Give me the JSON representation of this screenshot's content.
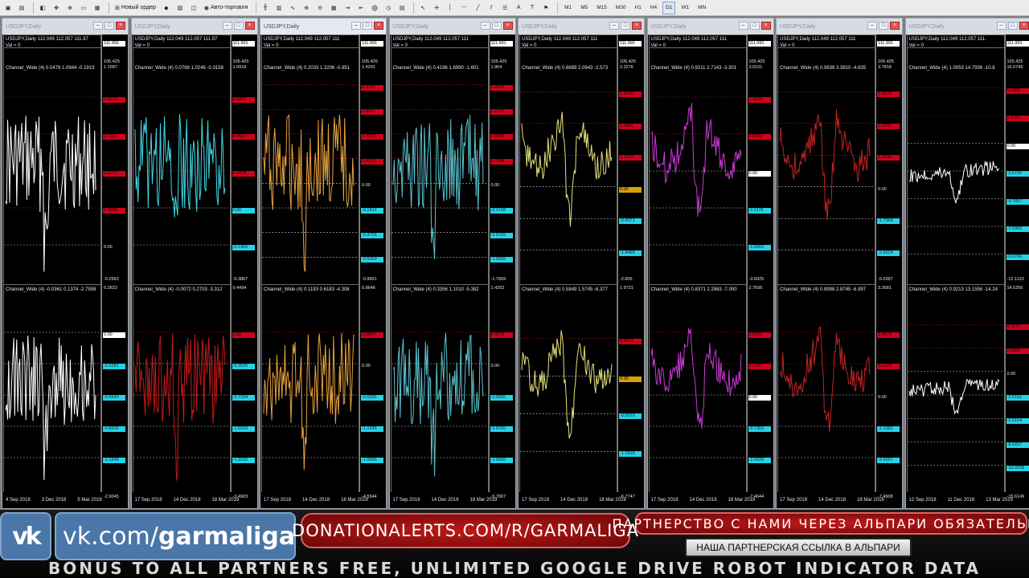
{
  "toolbar": {
    "new_order": "Новый ордер",
    "auto_trading": "Авто-торговля",
    "timeframes": [
      "M1",
      "M5",
      "M15",
      "M30",
      "H1",
      "H4",
      "D1",
      "W1",
      "MN"
    ],
    "active_timeframe": "D1",
    "draw_letters": [
      "A",
      "T"
    ]
  },
  "windows": [
    {
      "window_title": "USDJPY,Daily",
      "active": false,
      "symbol_label": "USDJPY,Daily  112.049 112.057 111.97",
      "val_label": "Val = 0",
      "ind1_label": "Channel_Wide (4) 0.0479 1.0944 -0.1919",
      "ind2_label": "Channel_Wide (4) -0.0361 0.1374 -2.7598",
      "price_top": "111.991",
      "price_low": "105.425",
      "ind1_top": "1.1587",
      "ind1_bottom": "-0.2563",
      "ind2_top": "0.2823",
      "ind2_bottom": "-2.9045",
      "ind1_levels": [
        {
          "text": "0.8679",
          "kind": "red"
        },
        {
          "text": "0.7112",
          "kind": "red"
        },
        {
          "text": "0.6077",
          "kind": "red"
        },
        {
          "text": "0.4646",
          "kind": "red"
        },
        {
          "text": "0.00",
          "kind": "black"
        }
      ],
      "ind2_levels": [
        {
          "text": "0.00",
          "kind": "white"
        },
        {
          "text": "-0.3281",
          "kind": "cyan"
        },
        {
          "text": "-0.6649",
          "kind": "cyan"
        },
        {
          "text": "-0.8626",
          "kind": "cyan"
        },
        {
          "text": "-1.1848",
          "kind": "cyan"
        }
      ],
      "dates": [
        "4 Sep 2018",
        "3 Dec 2018",
        "5 Mar 2019"
      ],
      "line_color": "#ffffff",
      "line_color2": "#ffffff"
    },
    {
      "window_title": "USDJPY,Daily",
      "active": false,
      "symbol_label": "USDJPY,Daily  112.049 112.057 111.97",
      "val_label": "Val = 0",
      "ind1_label": "Channel_Wide (4) 0.0768 1.0246 -0.3158",
      "ind2_label": "Channel_Wide (4) -0.0072 0.2703 -3.312",
      "price_top": "111.991",
      "price_low": "105.425",
      "ind1_top": "1.0918",
      "ind1_bottom": "-0.3867",
      "ind2_top": "0.4494",
      "ind2_bottom": "-3.4903",
      "ind1_levels": [
        {
          "text": "0.5862",
          "kind": "red"
        },
        {
          "text": "0.4612",
          "kind": "red"
        },
        {
          "text": "0.3479",
          "kind": "red"
        },
        {
          "text": "0.00",
          "kind": "cyan"
        },
        {
          "text": "-0.1460",
          "kind": "cyan"
        }
      ],
      "ind2_levels": [
        {
          "text": "0.00",
          "kind": "red"
        },
        {
          "text": "-0.3520",
          "kind": "cyan"
        },
        {
          "text": "-0.7334",
          "kind": "cyan"
        },
        {
          "text": "-1.0218",
          "kind": "cyan"
        },
        {
          "text": "-1.3195",
          "kind": "cyan"
        }
      ],
      "dates": [
        "17 Sep 2018",
        "14 Dec 2018",
        "18 Mar 2019"
      ],
      "line_color": "#3fd9e6",
      "line_color2": "#c11a1a"
    },
    {
      "window_title": "USDJPY,Daily",
      "active": true,
      "symbol_label": "USDJPY,Daily  112.049 112.057 111",
      "val_label": "Val = 0",
      "ind1_label": "Channel_Wide (4) 0.2033 1.3206 -0.851",
      "ind2_label": "Channel_Wide (4) 0.1193 0.6183 -4.308",
      "price_top": "111.991",
      "price_low": "105.425",
      "ind1_top": "1.4291",
      "ind1_bottom": "-0.9601",
      "ind2_top": "0.8646",
      "ind2_bottom": "-4.5544",
      "ind1_levels": [
        {
          "text": "0.9709",
          "kind": "red"
        },
        {
          "text": "0.8062",
          "kind": "red"
        },
        {
          "text": "0.7073",
          "kind": "red"
        },
        {
          "text": "0.4613",
          "kind": "red"
        },
        {
          "text": "0.00",
          "kind": "black"
        },
        {
          "text": "-0.1412",
          "kind": "cyan"
        },
        {
          "text": "-0.3725",
          "kind": "cyan"
        },
        {
          "text": "-0.6459",
          "kind": "cyan"
        }
      ],
      "ind2_levels": [
        {
          "text": "0.3664",
          "kind": "red"
        },
        {
          "text": "0.00",
          "kind": "black"
        },
        {
          "text": "-0.6595",
          "kind": "cyan"
        },
        {
          "text": "-1.1545",
          "kind": "cyan"
        },
        {
          "text": "-1.6886",
          "kind": "cyan"
        }
      ],
      "dates": [
        "17 Sep 2018",
        "14 Dec 2018",
        "18 Mar 2019"
      ],
      "line_color": "#e8a13e",
      "line_color2": "#e8a13e"
    },
    {
      "window_title": "USDJPY,Daily",
      "active": false,
      "symbol_label": "USDJPY,Daily  112.049 112.057 111",
      "val_label": "Val = 0",
      "ind1_label": "Channel_Wide (4) 0.4196 1.6990 -1.601",
      "ind2_label": "Channel_Wide (4) 0.3356 1.1010 -5.382",
      "price_top": "111.991",
      "price_low": "105.425",
      "ind1_top": "1.864",
      "ind1_bottom": "-1.7669",
      "ind2_top": "1.4252",
      "ind2_bottom": "-5.7067",
      "ind1_levels": [
        {
          "text": "1.4046",
          "kind": "red"
        },
        {
          "text": "1.0735",
          "kind": "red"
        },
        {
          "text": "0.9069",
          "kind": "red"
        },
        {
          "text": "0.7346",
          "kind": "red"
        },
        {
          "text": "0.00",
          "kind": "black"
        },
        {
          "text": "-0.2108",
          "kind": "cyan"
        },
        {
          "text": "-0.5339",
          "kind": "cyan"
        },
        {
          "text": "-1.0696",
          "kind": "cyan"
        }
      ],
      "ind2_levels": [
        {
          "text": "0.4379",
          "kind": "red"
        },
        {
          "text": "0.00",
          "kind": "black"
        },
        {
          "text": "-0.6835",
          "kind": "cyan"
        },
        {
          "text": "-0.9760",
          "kind": "cyan"
        },
        {
          "text": "-2.9550",
          "kind": "cyan"
        }
      ],
      "dates": [
        "17 Sep 2018",
        "14 Dec 2018",
        "18 Mar 2019"
      ],
      "line_color": "#59c3cf",
      "line_color2": "#59c3cf"
    },
    {
      "window_title": "USDJPY,Daily",
      "active": false,
      "symbol_label": "USDJPY,Daily  112.049 112.057 111",
      "val_label": "Val = 0",
      "ind1_label": "Channel_Wide (4) 0.6689 2.0943 -2.573",
      "ind2_label": "Channel_Wide (4) 0.5849 1.5745 -6.377",
      "price_top": "111.991",
      "price_low": "105.425",
      "ind1_top": "2.2276",
      "ind1_bottom": "-2.805",
      "ind2_top": "1.9721",
      "ind2_bottom": "-6.7747",
      "ind1_levels": [
        {
          "text": "1.5339",
          "kind": "red"
        },
        {
          "text": "1.0881",
          "kind": "red"
        },
        {
          "text": "0.7602",
          "kind": "red"
        },
        {
          "text": "0.00",
          "kind": "gold"
        },
        {
          "text": "-0.4371",
          "kind": "cyan"
        },
        {
          "text": "-1.4468",
          "kind": "cyan"
        }
      ],
      "ind2_levels": [
        {
          "text": "0.9221",
          "kind": "red"
        },
        {
          "text": "0.00",
          "kind": "gold"
        },
        {
          "text": "-0.5510",
          "kind": "cyan"
        },
        {
          "text": "-1.1818",
          "kind": "cyan"
        }
      ],
      "dates": [
        "17 Sep 2018",
        "14 Dec 2018",
        "18 Mar 2019"
      ],
      "line_color": "#e6e27a",
      "line_color2": "#e6e27a"
    },
    {
      "window_title": "USDJPY,Daily",
      "active": false,
      "symbol_label": "USDJPY,Daily  112.049 112.057 111",
      "val_label": "Val = 0",
      "ind1_label": "Channel_Wide (4) 0.9211 2.7143 -3.301",
      "ind2_label": "Channel_Wide (4) 0.8371 2.2863 -7.000",
      "price_top": "111.991",
      "price_low": "105.425",
      "ind1_top": "3.0151",
      "ind1_bottom": "-3.6025",
      "ind2_top": "2.7506",
      "ind2_bottom": "-7.4644",
      "ind1_levels": [
        {
          "text": "1.4835",
          "kind": "red"
        },
        {
          "text": "0.9602",
          "kind": "red"
        },
        {
          "text": "0.00",
          "kind": "white"
        },
        {
          "text": "-0.1176",
          "kind": "cyan"
        },
        {
          "text": "-1.5566",
          "kind": "cyan"
        }
      ],
      "ind2_levels": [
        {
          "text": "1.0000",
          "kind": "red"
        },
        {
          "text": "0.1467",
          "kind": "red"
        },
        {
          "text": "0.00",
          "kind": "white"
        },
        {
          "text": "-0.7363",
          "kind": "cyan"
        },
        {
          "text": "-2.6025",
          "kind": "cyan"
        }
      ],
      "dates": [
        "17 Sep 2018",
        "14 Dec 2018",
        "18 Mar 2019"
      ],
      "line_color": "#c83bd4",
      "line_color2": "#c83bd4"
    },
    {
      "window_title": "USDJPY,Daily",
      "active": false,
      "symbol_label": "USDJPY,Daily  112.049 112.057 111",
      "val_label": "Val = 0",
      "ind1_label": "Channel_Wide (4) 0.9838 3.3810 -4.635",
      "ind2_label": "Channel_Wide (4) 0.8998 2.8745 -6.997",
      "price_top": "111.991",
      "price_low": "105.425",
      "ind1_top": "3.7818",
      "ind1_bottom": "-5.0367",
      "ind2_top": "3.3681",
      "ind2_bottom": "-7.4908",
      "ind1_levels": [
        {
          "text": "2.6878",
          "kind": "red"
        },
        {
          "text": "2.2298",
          "kind": "red"
        },
        {
          "text": "1.2038",
          "kind": "red"
        },
        {
          "text": "0.00",
          "kind": "black"
        },
        {
          "text": "-1.7968",
          "kind": "cyan"
        },
        {
          "text": "-2.6624",
          "kind": "cyan"
        }
      ],
      "ind2_levels": [
        {
          "text": "1.8473",
          "kind": "red"
        },
        {
          "text": "0.6129",
          "kind": "red"
        },
        {
          "text": "0.00",
          "kind": "black"
        },
        {
          "text": "-1.1682",
          "kind": "cyan"
        },
        {
          "text": "-3.4257",
          "kind": "cyan"
        }
      ],
      "dates": [
        "17 Sep 2018",
        "14 Dec 2018",
        "18 Mar 2019"
      ],
      "line_color": "#c72222",
      "line_color2": "#c72222"
    },
    {
      "window_title": "USDJPY,Daily",
      "active": false,
      "symbol_label": "USDJPY,Daily  112.049 112.057 111.",
      "val_label": "Val = 0",
      "ind1_label": "Channel_Wide (4) 1.0053 14.7936 -10.8",
      "ind2_label": "Channel_Wide (4) 0.9213 13.1556 -14.24",
      "price_top": "111.991",
      "price_low": "105.425",
      "ind1_top": "16.0749",
      "ind1_bottom": "-12.1133",
      "ind2_top": "14.5256",
      "ind2_bottom": "-15.6149",
      "ind1_levels": [
        {
          "text": "5.1300",
          "kind": "red"
        },
        {
          "text": "2.1161",
          "kind": "red"
        },
        {
          "text": "0.00",
          "kind": "white"
        },
        {
          "text": "-2.6732",
          "kind": "cyan"
        },
        {
          "text": "-4.7857",
          "kind": "cyan"
        },
        {
          "text": "-7.0300",
          "kind": "cyan"
        },
        {
          "text": "-9.0766",
          "kind": "cyan"
        }
      ],
      "ind2_levels": [
        {
          "text": "4.2272",
          "kind": "red"
        },
        {
          "text": "1.0000",
          "kind": "red"
        },
        {
          "text": "0.00",
          "kind": "black"
        },
        {
          "text": "-3.5152",
          "kind": "cyan"
        },
        {
          "text": "-5.6154",
          "kind": "cyan"
        },
        {
          "text": "-8.0257",
          "kind": "cyan"
        },
        {
          "text": "-10.3258",
          "kind": "cyan"
        }
      ],
      "dates": [
        "12 Sep 2018",
        "11 Dec 2018",
        "13 Mar 2019"
      ],
      "line_color": "#ffffff",
      "line_color2": "#ffffff"
    }
  ],
  "banner": {
    "vk_logo": "vk",
    "vk_url_prefix": "vk.com/",
    "vk_url_name": "garmaliga",
    "donation": "DONATIONALERTS.COM/R/GARMALIGA",
    "partner": "ПАРТНЕРСТВО С НАМИ ЧЕРЕЗ АЛЬПАРИ ОБЯЗАТЕЛЬНО",
    "partner_link": "НАША ПАРТНЕРСКАЯ ССЫЛКА В АЛЬПАРИ",
    "bonus": "BONUS TO ALL PARTNERS FREE, UNLIMITED GOOGLE DRIVE ROBOT INDICATOR DATA"
  },
  "colors": {
    "red_level": "#d0021b",
    "cyan_level": "#25d2e6",
    "accent_vk": "#4a76a8",
    "banner_red": "#c01818"
  }
}
